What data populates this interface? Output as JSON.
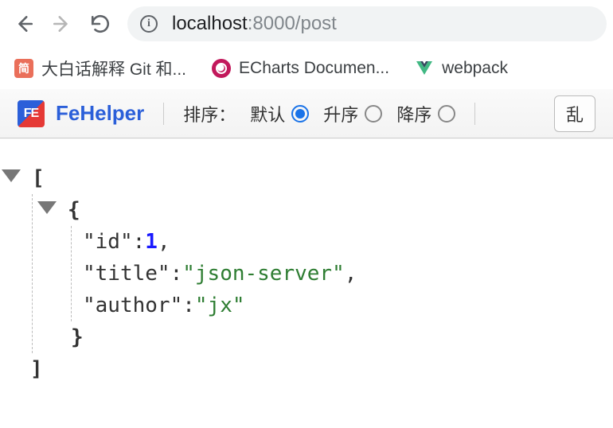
{
  "browser": {
    "url_host": "localhost",
    "url_port": ":8000",
    "url_path": "/post"
  },
  "bookmarks": [
    {
      "icon": "jian",
      "label": "大白话解释 Git 和..."
    },
    {
      "icon": "echarts",
      "label": "ECharts Documen..."
    },
    {
      "icon": "vue",
      "label": "webpack"
    }
  ],
  "fehelper": {
    "title": "FeHelper",
    "sort_label": "排序：",
    "options": {
      "default": "默认",
      "asc": "升序",
      "desc": "降序"
    },
    "selected": "default",
    "action_button": "乱"
  },
  "json_content": {
    "array_open": "[",
    "obj_open": "{",
    "rows": [
      {
        "key": "\"id\"",
        "sep": ": ",
        "value": "1",
        "type": "num",
        "trail": ","
      },
      {
        "key": "\"title\"",
        "sep": ": ",
        "value": "\"json-server\"",
        "type": "str",
        "trail": ","
      },
      {
        "key": "\"author\"",
        "sep": ": ",
        "value": "\"jx\"",
        "type": "str",
        "trail": ""
      }
    ],
    "obj_close": "}",
    "array_close": "]"
  }
}
